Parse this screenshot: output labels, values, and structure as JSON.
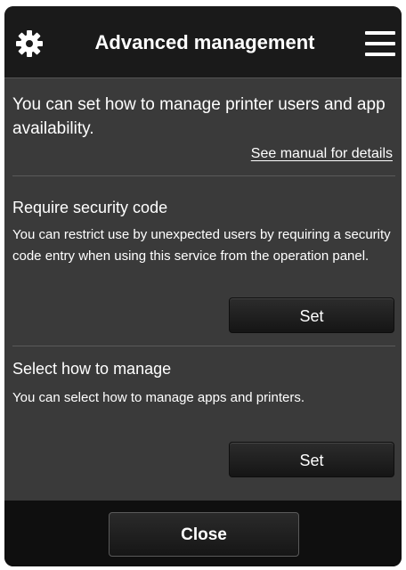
{
  "header": {
    "title": "Advanced management",
    "settings_icon": "gear-icon",
    "menu_icon": "hamburger-menu-icon"
  },
  "intro": {
    "text": "You can set how to manage printer users and app availability.",
    "manual_link": "See manual for details"
  },
  "sections": [
    {
      "title": "Require security code",
      "description": "You can restrict use by unexpected users by requiring a security code entry when using this service from the operation panel.",
      "button_label": "Set"
    },
    {
      "title": "Select how to manage",
      "description": "You can select how to manage apps and printers.",
      "button_label": "Set"
    }
  ],
  "footer": {
    "close_label": "Close"
  },
  "colors": {
    "panel_background": "#3a3a3a",
    "header_background": "#1a1a1a",
    "footer_background": "#0f0f0f",
    "text": "#ffffff"
  }
}
